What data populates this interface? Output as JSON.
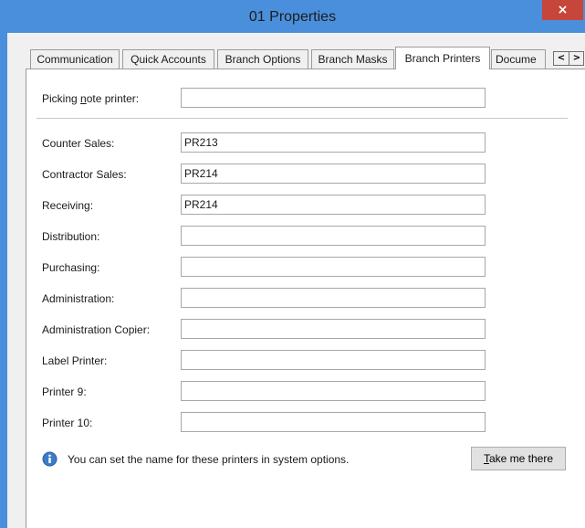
{
  "window": {
    "title": "01 Properties",
    "close_glyph": "×",
    "icon": "close-icon"
  },
  "tabs": [
    {
      "label": "Communication",
      "active": false
    },
    {
      "label": "Quick Accounts",
      "active": false
    },
    {
      "label": "Branch Options",
      "active": false
    },
    {
      "label": "Branch Masks",
      "active": false
    },
    {
      "label": "Branch Printers",
      "active": true
    },
    {
      "label": "Docume",
      "active": false
    }
  ],
  "tab_scroll": {
    "left_glyph": "<",
    "right_glyph": ">"
  },
  "picking": {
    "label_pre": "Picking ",
    "label_mnemonic": "n",
    "label_post": "ote printer:",
    "value": ""
  },
  "printers": [
    {
      "label": "Counter Sales:",
      "value": "PR213"
    },
    {
      "label": "Contractor Sales:",
      "value": "PR214"
    },
    {
      "label": "Receiving:",
      "value": "PR214"
    },
    {
      "label": "Distribution:",
      "value": ""
    },
    {
      "label": "Purchasing:",
      "value": ""
    },
    {
      "label": "Administration:",
      "value": ""
    },
    {
      "label": "Administration Copier:",
      "value": ""
    },
    {
      "label": "Label Printer:",
      "value": ""
    },
    {
      "label": "Printer 9:",
      "value": ""
    },
    {
      "label": "Printer 10:",
      "value": ""
    }
  ],
  "info": {
    "icon": "info-icon",
    "text": "You can set the name for these printers in system options."
  },
  "take_button": {
    "mnemonic": "T",
    "rest": "ake me there"
  },
  "colors": {
    "title_bar": "#4a8fdc",
    "close_button": "#c7463b"
  }
}
